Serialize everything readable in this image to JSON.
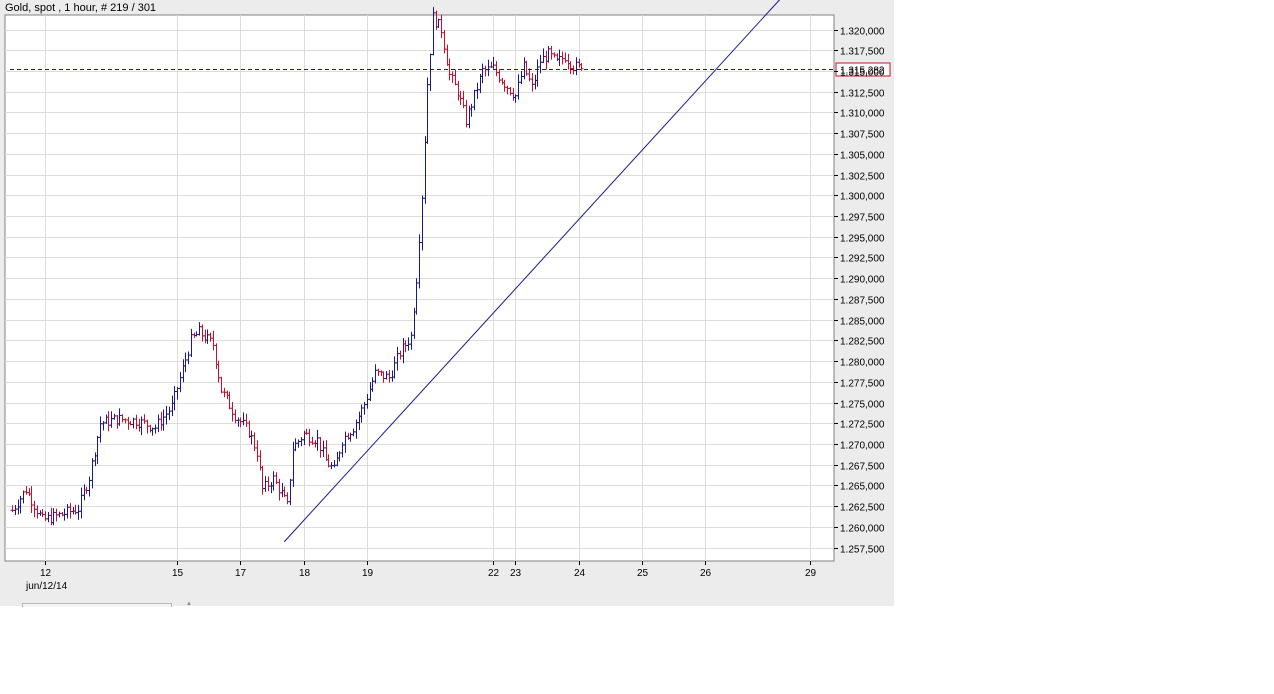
{
  "window": {
    "title": "Gold, spot , 1 hour, # 219 / 301",
    "date_label": "jun/12/14"
  },
  "colors": {
    "panel_bg": "#ececec",
    "plot_bg": "#ffffff",
    "grid": "#dcdcdc",
    "up_bar": "#1a1a8c",
    "down_bar": "#c8102e",
    "trendline": "#1a1a8c",
    "price_line": "#1a1a8c",
    "price_box": "#c8102e"
  },
  "chart_data": {
    "type": "ohlc",
    "instrument": "Gold, spot",
    "timeframe": "1 hour",
    "ylim": [
      1256000,
      1325000
    ],
    "xlim": [
      0,
      301
    ],
    "y_ticks": [
      1257500,
      1260000,
      1262500,
      1265000,
      1267500,
      1270000,
      1272500,
      1275000,
      1277500,
      1280000,
      1282500,
      1285000,
      1287500,
      1290000,
      1292500,
      1295000,
      1297500,
      1300000,
      1302500,
      1305000,
      1307500,
      1310000,
      1312500,
      1315000,
      1317500,
      1320000
    ],
    "y_tick_labels": [
      "1.257,500",
      "1.260,000",
      "1.262,500",
      "1.265,000",
      "1.267,500",
      "1.270,000",
      "1.272,500",
      "1.275,000",
      "1.277,500",
      "1.280,000",
      "1.282,500",
      "1.285,000",
      "1.287,500",
      "1.290,000",
      "1.292,500",
      "1.295,000",
      "1.297,500",
      "1.300,000",
      "1.302,500",
      "1.305,000",
      "1.307,500",
      "1.310,000",
      "1.312,500",
      "1.315,000",
      "1.317,500",
      "1.320,000"
    ],
    "x_ticks": [
      {
        "label": "12",
        "x": 12
      },
      {
        "label": "15",
        "x": 60
      },
      {
        "label": "17",
        "x": 83
      },
      {
        "label": "18",
        "x": 106
      },
      {
        "label": "19",
        "x": 129
      },
      {
        "label": "22",
        "x": 175
      },
      {
        "label": "23",
        "x": 183
      },
      {
        "label": "24",
        "x": 206
      },
      {
        "label": "25",
        "x": 229
      },
      {
        "label": "26",
        "x": 252
      },
      {
        "label": "29",
        "x": 290
      }
    ],
    "current_price": 1315282,
    "current_price_label": "1.315,282",
    "trendline": {
      "x1": 99,
      "y1": 1258200,
      "x2": 283,
      "y2": 1325000
    },
    "anchors": [
      [
        0,
        1262000
      ],
      [
        5,
        1264500
      ],
      [
        11,
        1260800
      ],
      [
        18,
        1261500
      ],
      [
        24,
        1262200
      ],
      [
        28,
        1266000
      ],
      [
        32,
        1272500
      ],
      [
        38,
        1273000
      ],
      [
        45,
        1272800
      ],
      [
        52,
        1272000
      ],
      [
        58,
        1274500
      ],
      [
        65,
        1282500
      ],
      [
        68,
        1283500
      ],
      [
        73,
        1282000
      ],
      [
        76,
        1276500
      ],
      [
        81,
        1273500
      ],
      [
        86,
        1271500
      ],
      [
        89,
        1269000
      ],
      [
        91,
        1264500
      ],
      [
        95,
        1265800
      ],
      [
        98,
        1264000
      ],
      [
        100,
        1262500
      ],
      [
        102,
        1269500
      ],
      [
        106,
        1271200
      ],
      [
        111,
        1270500
      ],
      [
        114,
        1268000
      ],
      [
        117,
        1266800
      ],
      [
        120,
        1270500
      ],
      [
        124,
        1272000
      ],
      [
        128,
        1274800
      ],
      [
        132,
        1278500
      ],
      [
        137,
        1278000
      ],
      [
        141,
        1281000
      ],
      [
        145,
        1283000
      ],
      [
        147,
        1290000
      ],
      [
        149,
        1300000
      ],
      [
        151,
        1313500
      ],
      [
        153,
        1321500
      ],
      [
        156,
        1320000
      ],
      [
        159,
        1314500
      ],
      [
        162,
        1312500
      ],
      [
        165,
        1309000
      ],
      [
        168,
        1312000
      ],
      [
        171,
        1315000
      ],
      [
        175,
        1315300
      ],
      [
        179,
        1313500
      ],
      [
        183,
        1312000
      ],
      [
        186,
        1315500
      ],
      [
        189,
        1313000
      ],
      [
        192,
        1316200
      ],
      [
        195,
        1317000
      ],
      [
        198,
        1316000
      ],
      [
        201,
        1316800
      ],
      [
        204,
        1315600
      ],
      [
        207,
        1315282
      ]
    ]
  }
}
